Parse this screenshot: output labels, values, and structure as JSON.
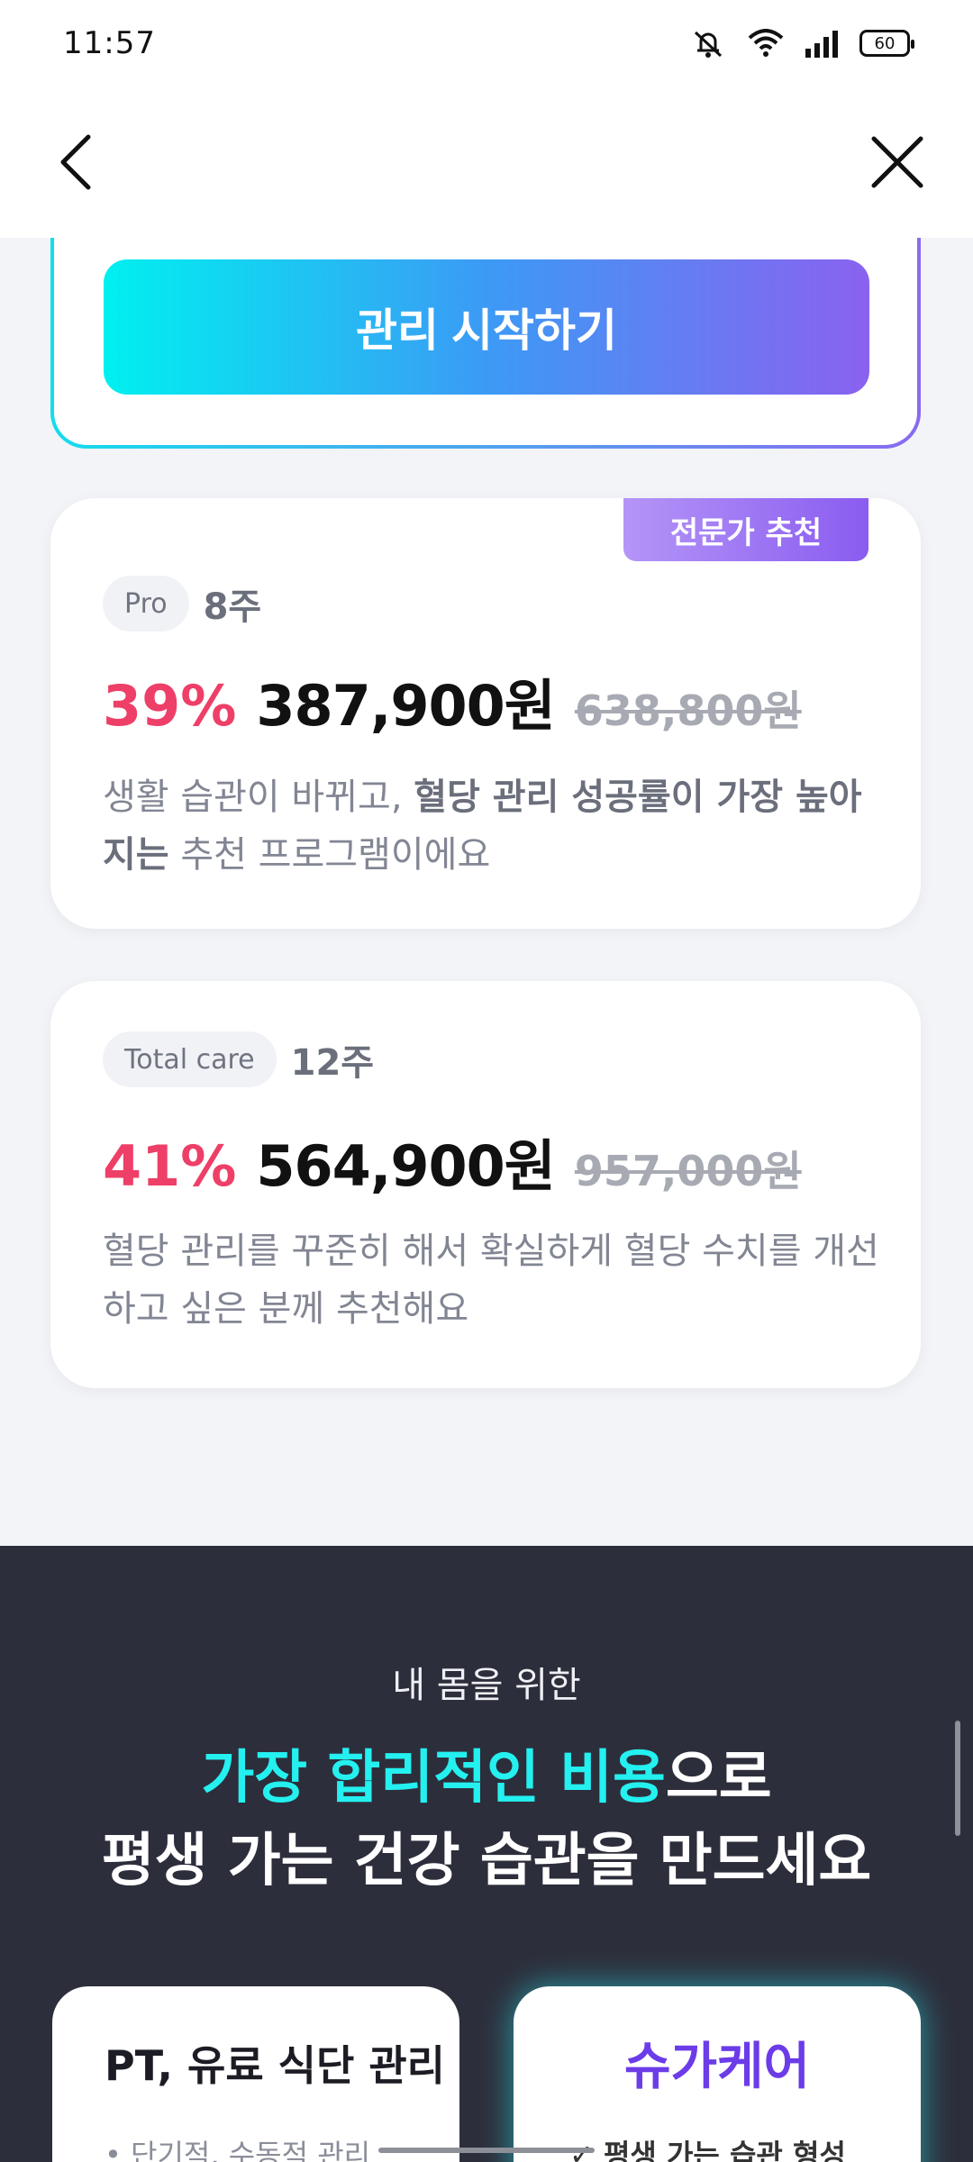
{
  "status_bar": {
    "time": "11:57",
    "battery": "60"
  },
  "start": {
    "button_label": "관리 시작하기"
  },
  "plans": [
    {
      "badge": "전문가 추천",
      "tag": "Pro",
      "weeks": "8주",
      "discount": "39%",
      "price": "387,900원",
      "original_price": "638,800원",
      "desc_prefix": "생활 습관이 바뀌고, ",
      "desc_bold": "혈당 관리 성공률이 가장 높아지는",
      "desc_suffix": " 추천 프로그램이에요"
    },
    {
      "tag": "Total care",
      "weeks": "12주",
      "discount": "41%",
      "price": "564,900원",
      "original_price": "957,000원",
      "desc": "혈당 관리를 꾸준히 해서 확실하게 혈당 수치를 개선하고 싶은 분께 추천해요"
    }
  ],
  "promo": {
    "subtitle": "내 몸을 위한",
    "title_highlight": "가장 합리적인 비용",
    "title_rest": "으로",
    "title_line2": "평생 가는 건강 습관을 만드세요"
  },
  "compare": {
    "left_title": "PT, 유료 식단 관리",
    "left_item": "• 단기적, 수동적 관리",
    "right_title": "슈가케어",
    "right_item": "✓ 평생 가는 습관 형성"
  }
}
